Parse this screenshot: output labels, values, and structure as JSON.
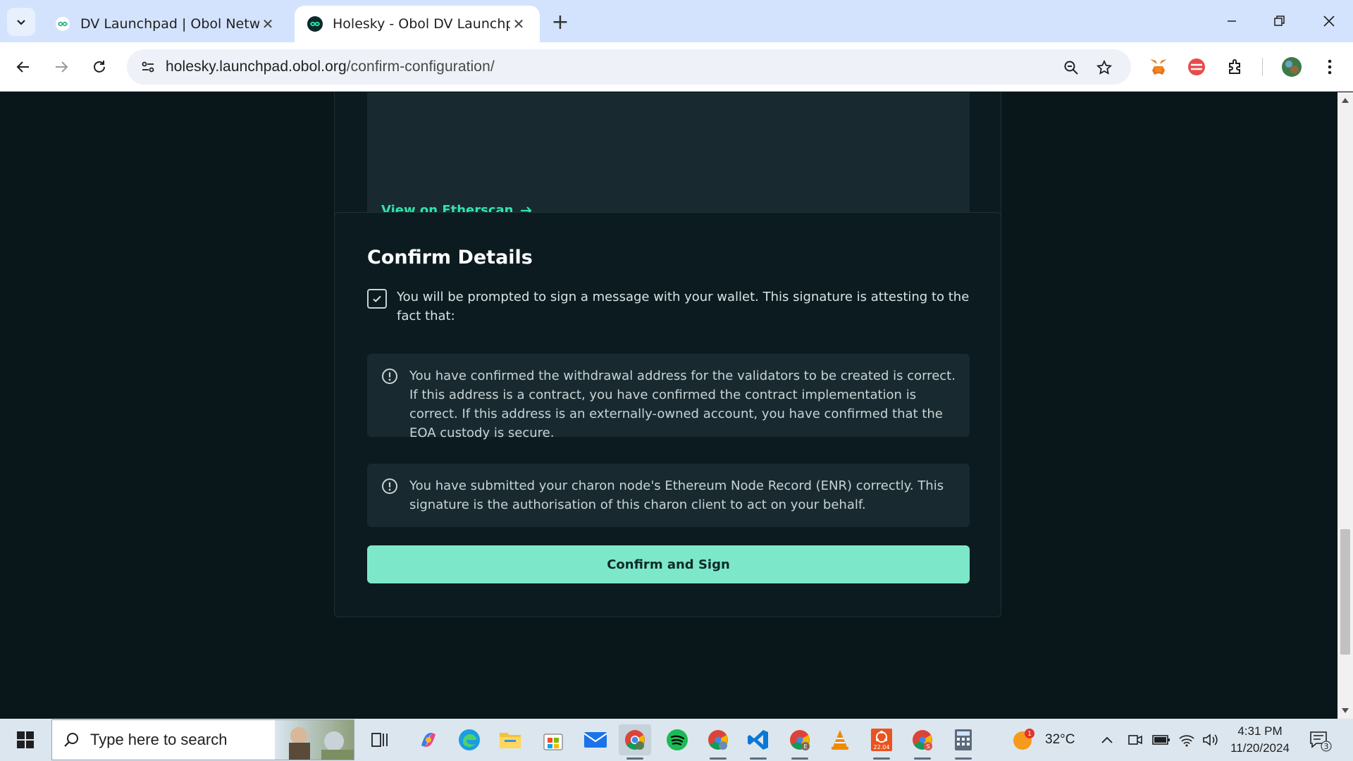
{
  "browser": {
    "tabs": [
      {
        "title": "DV Launchpad | Obol Network",
        "active": false
      },
      {
        "title": "Holesky - Obol DV Launchpad",
        "active": true
      }
    ],
    "url_host": "holesky.launchpad.obol.org",
    "url_path": "/confirm-configuration/"
  },
  "page": {
    "etherscan_link": "View on Etherscan",
    "confirm": {
      "title": "Confirm Details",
      "checkbox_checked": true,
      "checkbox_text": "You will be prompted to sign a message with your wallet. This signature is attesting to the fact that:",
      "notices": [
        "You have confirmed the withdrawal address for the validators to be created is correct. If this address is a contract, you have confirmed the contract implementation is correct. If this address is an externally-owned account, you have confirmed that the EOA custody is secure.",
        "You have submitted your charon node's Ethereum Node Record (ENR) correctly. This signature is the authorisation of this charon client to act on your behalf."
      ],
      "button_label": "Confirm and Sign"
    }
  },
  "taskbar": {
    "search_placeholder": "Type here to search",
    "weather_temp": "32°C",
    "weather_badge": "1",
    "time": "4:31 PM",
    "date": "11/20/2024",
    "notification_count": "3",
    "app_badge_ubuntu": "22.04",
    "app_badge_chrome_e": "E",
    "app_badge_chrome_s": "S"
  },
  "colors": {
    "page_bg": "#09161a",
    "accent": "#2fe4ab",
    "button_bg": "#7de8c9",
    "tabbar_bg": "#d3e3fd"
  }
}
